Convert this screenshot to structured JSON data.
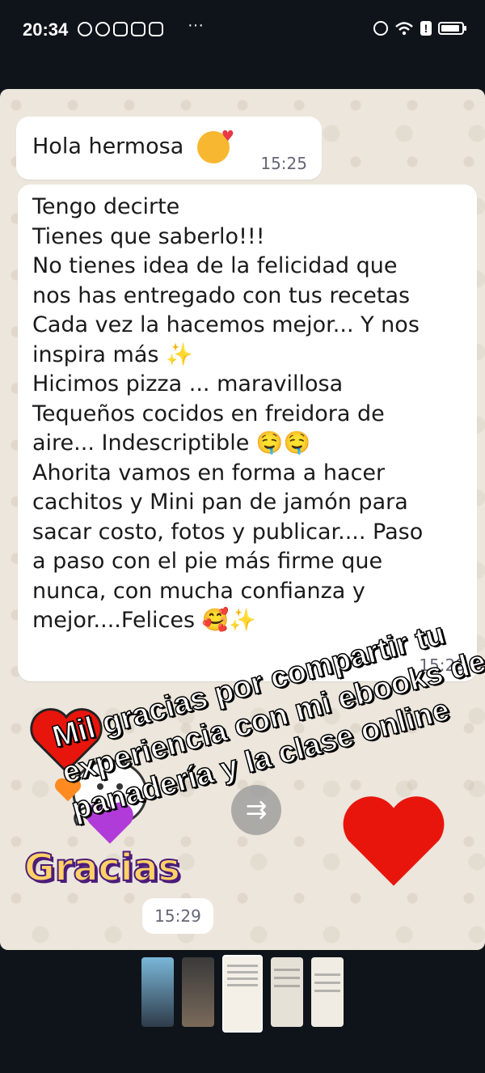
{
  "status_bar": {
    "time": "20:34",
    "overflow": "···",
    "notification_icons": [
      "whatsapp-business-icon",
      "whatsapp-icon",
      "instagram-icon",
      "instagram-icon",
      "instagram-icon"
    ],
    "system_icons": [
      "alarm-icon",
      "wifi-icon",
      "alert-icon",
      "battery-icon"
    ],
    "alert_symbol": "!"
  },
  "chat": {
    "message1": {
      "text": "Hola hermosa",
      "emoji": "face-blowing-kiss",
      "time": "15:25"
    },
    "message2": {
      "lines": [
        "Tengo decirte",
        "Tienes que saberlo!!!",
        "No tienes idea de la felicidad que",
        "nos has entregado con tus recetas",
        "Cada vez la hacemos mejor... Y nos",
        "inspira más ✨",
        "Hicimos pizza ... maravillosa",
        "Tequeños cocidos en freidora de",
        "aire... Indescriptible 🤤🤤",
        "Ahorita vamos en forma a hacer",
        "cachitos y Mini pan de jamón para",
        "sacar costo, fotos y publicar.... Paso",
        "a paso con el pie más firme que",
        "nunca, con mucha confianza y",
        "mejor....Felices 🥰✨"
      ],
      "time": "15:29"
    },
    "sticker": {
      "text": "Gracias",
      "time": "15:29"
    }
  },
  "overlay": {
    "lines": [
      "Mil gracias por compartir tu",
      "experiencia con mi ebooks de",
      "panadería y la clase online"
    ]
  },
  "forward_button": {
    "icon": "forward-icon",
    "symbol": "⇉"
  },
  "thumbnails": [
    {
      "state": "inactive"
    },
    {
      "state": "inactive"
    },
    {
      "state": "active"
    },
    {
      "state": "inactive"
    },
    {
      "state": "inactive"
    }
  ],
  "colors": {
    "background": "#0f141a",
    "chat_background": "#ece6dc",
    "bubble": "#ffffff",
    "heart_red": "#e8150c"
  }
}
